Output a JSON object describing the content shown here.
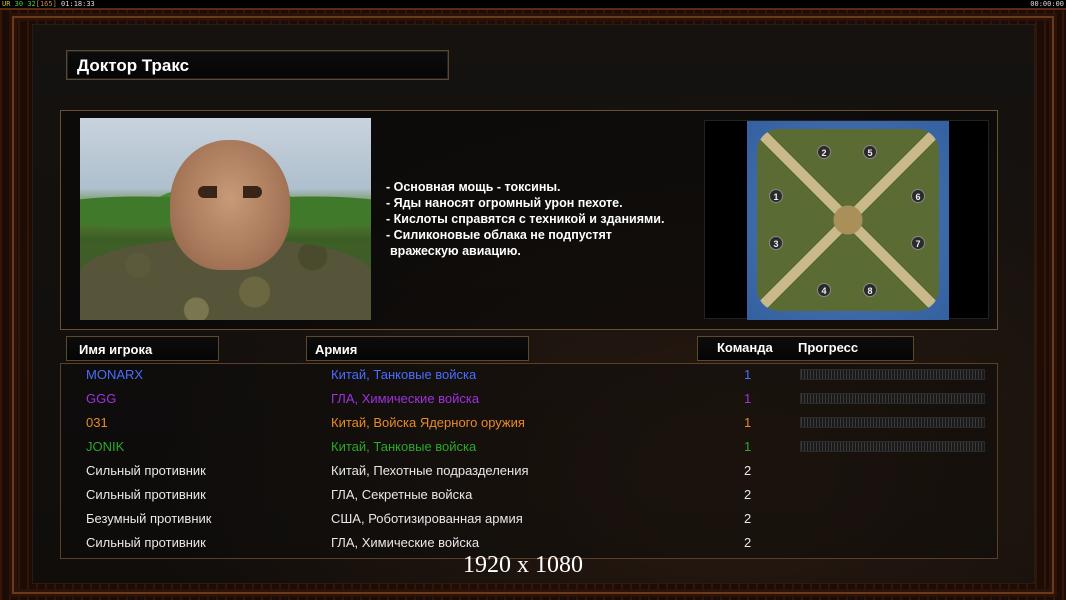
{
  "hud": {
    "ur": "UR",
    "fps_a": "30",
    "fps_b": "32",
    "bracket": "[165]",
    "clock": "01:18:33",
    "right_clock": "00:00:00"
  },
  "general": {
    "name": "Доктор Тракс",
    "bullets": [
      "- Основная мощь - токсины.",
      "- Яды наносят огромный урон пехоте.",
      "- Кислоты справятся с техникой и зданиями.",
      "- Силиконовые облака не подпустят",
      " вражескую авиацию."
    ]
  },
  "map": {
    "bases": [
      "1",
      "2",
      "3",
      "4",
      "5",
      "6",
      "7",
      "8"
    ]
  },
  "columns": {
    "player": "Имя игрока",
    "army": "Армия",
    "team": "Команда",
    "progress": "Прогресс"
  },
  "players": [
    {
      "name": "MONARX",
      "army": "Китай, Танковые войска",
      "team": "1",
      "color": "#4a6cff",
      "progress": 0.0
    },
    {
      "name": "GGG",
      "army": "ГЛА, Химические войска",
      "team": "1",
      "color": "#a030e0",
      "progress": 0.0
    },
    {
      "name": "031",
      "army": "Китай, Войска Ядерного оружия",
      "team": "1",
      "color": "#e88a28",
      "progress": 0.0
    },
    {
      "name": "JONIK",
      "army": "Китай, Танковые войска",
      "team": "1",
      "color": "#2aa82a",
      "progress": 0.0
    },
    {
      "name": "Сильный противник",
      "army": "Китай, Пехотные подразделения",
      "team": "2",
      "color": "#e8e8e8",
      "progress": null
    },
    {
      "name": "Сильный противник",
      "army": "ГЛА, Секретные войска",
      "team": "2",
      "color": "#e8e8e8",
      "progress": null
    },
    {
      "name": "Безумный противник",
      "army": "США, Роботизированная армия",
      "team": "2",
      "color": "#e8e8e8",
      "progress": null
    },
    {
      "name": "Сильный противник",
      "army": "ГЛА, Химические войска",
      "team": "2",
      "color": "#e8e8e8",
      "progress": null
    }
  ],
  "resolution_label": "1920 x 1080"
}
